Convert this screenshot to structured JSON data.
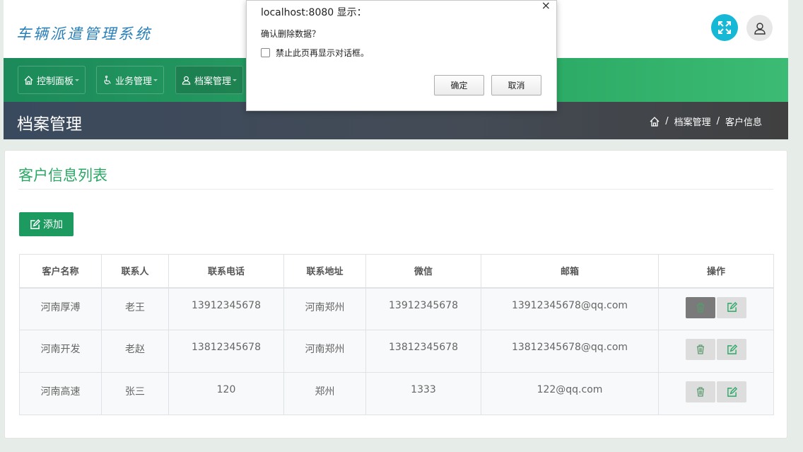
{
  "app": {
    "title": "车辆派遣管理系统"
  },
  "nav": {
    "items": [
      {
        "label": "控制面板",
        "icon": "home-icon"
      },
      {
        "label": "业务管理",
        "icon": "accessible-icon"
      },
      {
        "label": "档案管理",
        "icon": "user-icon"
      }
    ]
  },
  "header": {
    "page_title": "档案管理",
    "breadcrumb": [
      "档案管理",
      "客户信息"
    ],
    "breadcrumb_sep": "/"
  },
  "content": {
    "card_title": "客户信息列表",
    "add_label": "添加",
    "columns": [
      "客户名称",
      "联系人",
      "联系电话",
      "联系地址",
      "微信",
      "邮箱",
      "操作"
    ],
    "rows": [
      [
        "河南厚溥",
        "老王",
        "13912345678",
        "河南郑州",
        "13912345678",
        "13912345678@qq.com"
      ],
      [
        "河南开发",
        "老赵",
        "13812345678",
        "河南郑州",
        "13812345678",
        "13812345678@qq.com"
      ],
      [
        "河南高速",
        "张三",
        "120",
        "郑州",
        "1333",
        "122@qq.com"
      ]
    ]
  },
  "dialog": {
    "title": "localhost:8080 显示：",
    "close": "×",
    "message": "确认删除数据？",
    "checkbox_label": "禁止此页再显示对话框。",
    "ok_label": "确定",
    "cancel_label": "取消"
  },
  "colors": {
    "accent": "#2ba866",
    "expand_button": "#17b8d6",
    "nav_bg": "#1c8a5a",
    "header_bg": "#3a4a5e"
  }
}
